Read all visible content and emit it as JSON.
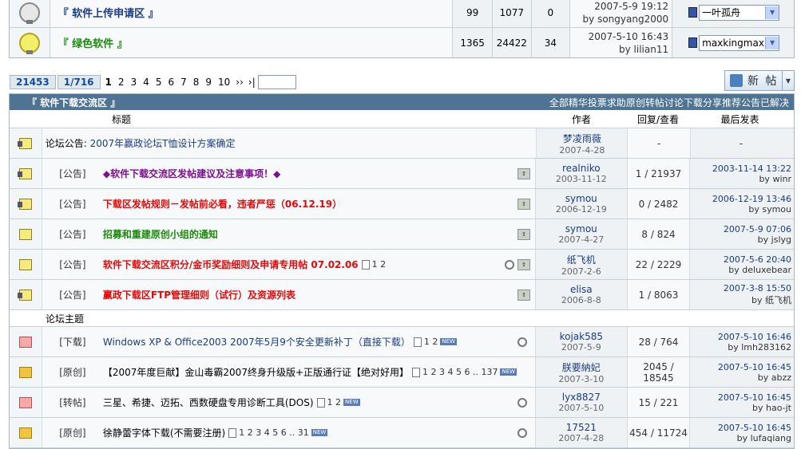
{
  "forums": [
    {
      "name": "『 软件上传申请区 』",
      "threads": "99",
      "posts": "1077",
      "today": "0",
      "last_date": "2007-5-9 19:12",
      "last_by": "by songyang2000",
      "moderator": "一叶孤舟",
      "lit": false
    },
    {
      "name": "『 绿色软件 』",
      "threads": "1365",
      "posts": "24422",
      "today": "34",
      "last_date": "2007-5-10 16:43",
      "last_by": "by lilian11",
      "moderator": "maxkingmax",
      "lit": true
    }
  ],
  "pager": {
    "total": "21453",
    "page_of": "1/716",
    "current": "1",
    "pages": [
      "2",
      "3",
      "4",
      "5",
      "6",
      "7",
      "8",
      "9",
      "10"
    ],
    "next": "››",
    "last": "›|"
  },
  "new_button": {
    "label": "新 帖"
  },
  "board": {
    "title": "『 软件下载交流区 』",
    "filters": [
      "全部",
      "精华",
      "投票",
      "求助",
      "原创",
      "转帖",
      "讨论",
      "下载",
      "分享",
      "推荐",
      "公告",
      "已解决"
    ]
  },
  "columns": {
    "title": "标题",
    "author": "作者",
    "replies": "回复/查看",
    "last": "最后发表"
  },
  "announcement": {
    "prefix": "论坛公告: ",
    "text": "2007年赢政论坛T恤设计方案确定",
    "author": "梦凌雨薇",
    "date": "2007-4-28",
    "replies": "-",
    "last": "-"
  },
  "sticky": [
    {
      "tag": "[公告]",
      "title": "◆软件下载交流区发帖建议及注意事项！◆",
      "color": "purple",
      "author": "realniko",
      "date": "2003-11-12",
      "replies": "1",
      "views": "21937",
      "last_date": "2003-11-14 13:22",
      "last_by": "by winr",
      "pages": "",
      "clip": false,
      "icon": "locked"
    },
    {
      "tag": "[公告]",
      "title": "下载区发帖规则－发帖前必看，违者严惩（06.12.19）",
      "color": "red",
      "author": "symou",
      "date": "2006-12-19",
      "replies": "0",
      "views": "2482",
      "last_date": "2006-12-19 13:46",
      "last_by": "by symou",
      "pages": "",
      "clip": false,
      "icon": "locked"
    },
    {
      "tag": "[公告]",
      "title": "招募和重建原创小组的通知",
      "color": "green",
      "author": "symou",
      "date": "2007-4-27",
      "replies": "8",
      "views": "824",
      "last_date": "2007-5-9 07:06",
      "last_by": "by jslyg",
      "pages": "",
      "clip": false,
      "icon": "normal"
    },
    {
      "tag": "[公告]",
      "title": "软件下载交流区积分/金币奖励细则及申请专用帖  07.02.06",
      "color": "red",
      "author": "纸飞机",
      "date": "2007-2-6",
      "replies": "22",
      "views": "2229",
      "last_date": "2007-5-6 20:40",
      "last_by": "by deluxebear",
      "pages": "1 2",
      "clip": true,
      "icon": "normal"
    },
    {
      "tag": "[公告]",
      "title": "赢政下载区FTP管理细则（试行）及资源列表",
      "color": "red",
      "author": "elisa",
      "date": "2006-8-8",
      "replies": "1",
      "views": "8063",
      "last_date": "2007-3-8 15:50",
      "last_by": "by 纸飞机",
      "pages": "",
      "clip": false,
      "icon": "locked"
    }
  ],
  "section_label": "论坛主题",
  "threads": [
    {
      "tag": "[下载]",
      "title": "Windows XP & Office2003 2007年5月9个安全更新补丁（直接下载）",
      "color": "blue",
      "author": "kojak585",
      "date": "2007-5-9",
      "replies": "28",
      "views": "764",
      "last_date": "2007-5-10 16:46",
      "last_by": "by lmh283162",
      "pages": "1 2",
      "new": true,
      "clip": true,
      "icon": "hot"
    },
    {
      "tag": "[原创]",
      "title": "【2007年度巨献】金山毒霸2007终身升级版+正版通行证【绝对好用】",
      "color": "black",
      "author": "朕要納妃",
      "date": "2007-3-10",
      "replies": "2045",
      "views": "18545",
      "last_date": "2007-5-10 16:45",
      "last_by": "by abzz",
      "pages": "1 2 3 4 5 6 .. 137",
      "new": true,
      "clip": false,
      "icon": "gold"
    },
    {
      "tag": "[转帖]",
      "title": "三星、希捷、迈拓、西数硬盘专用诊断工具(DOS)",
      "color": "black",
      "author": "lyx8827",
      "date": "2007-5-10",
      "replies": "15",
      "views": "221",
      "last_date": "2007-5-10 16:45",
      "last_by": "by hao-jt",
      "pages": "1 2",
      "new": true,
      "clip": true,
      "icon": "hot"
    },
    {
      "tag": "[原创]",
      "title": "徐静蕾字体下载(不需要注册)",
      "color": "black",
      "author": "17521",
      "date": "2007-4-28",
      "replies": "454",
      "views": "11724",
      "last_date": "2007-5-10 16:45",
      "last_by": "by lufaqiang",
      "pages": "1 2 3 4 5 6 .. 31",
      "new": true,
      "clip": true,
      "icon": "gold"
    }
  ]
}
